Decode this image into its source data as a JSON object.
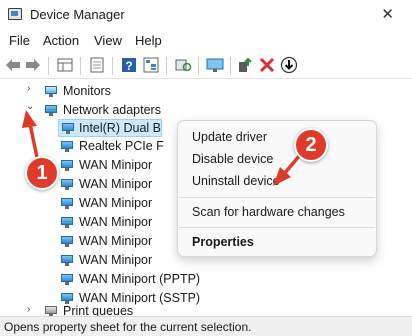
{
  "window": {
    "title": "Device Manager",
    "close_glyph": "✕"
  },
  "menu": [
    "File",
    "Action",
    "View",
    "Help"
  ],
  "toolbar": {
    "icons": [
      "back-arrow-icon",
      "forward-arrow-icon",
      "properties-grid-icon",
      "page-icon",
      "help-icon",
      "tree-view-icon",
      "scan-hardware-icon",
      "monitor-icon",
      "update-driver-icon",
      "uninstall-x-icon",
      "download-icon"
    ],
    "colors": {
      "uninstall": "#d32f2f",
      "help": "#2a5db0"
    }
  },
  "tree": {
    "monitors": "Monitors",
    "network_adapters": "Network adapters",
    "devices": [
      "Intel(R) Dual B",
      "Realtek PCIe F",
      "WAN Minipor",
      "WAN Minipor",
      "WAN Minipor",
      "WAN Minipor",
      "WAN Minipor",
      "WAN Minipor",
      "WAN Miniport (PPTP)",
      "WAN Miniport (SSTP)"
    ],
    "next_category": "Print queues",
    "expander_collapsed": "›",
    "expander_expanded": "⌄"
  },
  "context_menu": {
    "update_driver": "Update driver",
    "disable_device": "Disable device",
    "uninstall_device": "Uninstall device",
    "scan_hardware": "Scan for hardware changes",
    "properties": "Properties"
  },
  "annotations": {
    "step1": "1",
    "step2": "2",
    "color": "#e03a2b"
  },
  "status": {
    "text": "Opens property sheet for the current selection."
  }
}
